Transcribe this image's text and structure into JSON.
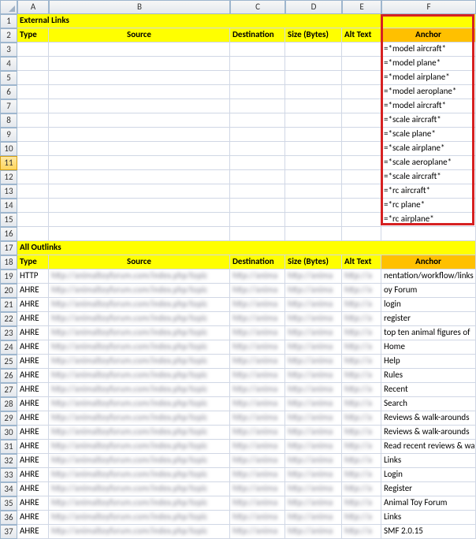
{
  "columns": [
    "A",
    "B",
    "C",
    "D",
    "E",
    "F"
  ],
  "rows": [
    1,
    2,
    3,
    4,
    5,
    6,
    7,
    8,
    9,
    10,
    11,
    12,
    13,
    14,
    15,
    16,
    17,
    18,
    19,
    20,
    21,
    22,
    23,
    24,
    25,
    26,
    27,
    28,
    29,
    30,
    31,
    32,
    33,
    34,
    35,
    36,
    37
  ],
  "selectedRow": 11,
  "section1": {
    "title": "External Links",
    "headers": {
      "type": "Type",
      "source": "Source",
      "destination": "Destination",
      "size": "Size (Bytes)",
      "alt": "Alt Text",
      "anchor": "Anchor"
    },
    "anchors": [
      "=*model aircraft*",
      "=*model plane*",
      "=*model airplane*",
      "=*model aeroplane*",
      "=*model aircraft*",
      "=*scale aircraft*",
      "=*scale plane*",
      "=*scale airplane*",
      "=*scale aeroplane*",
      "=*scale aircraft*",
      "=*rc aircraft*",
      "=*rc plane*",
      "=*rc airplane*"
    ]
  },
  "section2": {
    "title": "All Outlinks",
    "headers": {
      "type": "Type",
      "source": "Source",
      "destination": "Destination",
      "size": "Size (Bytes)",
      "alt": "Alt Text",
      "anchor": "Anchor"
    },
    "rows": [
      {
        "type": "HTTP",
        "anchor": "nentation/workflow/links"
      },
      {
        "type": "AHRE",
        "anchor": "oy Forum"
      },
      {
        "type": "AHRE",
        "anchor": "login"
      },
      {
        "type": "AHRE",
        "anchor": "register"
      },
      {
        "type": "AHRE",
        "anchor": "top ten animal figures of"
      },
      {
        "type": "AHRE",
        "anchor": "Home"
      },
      {
        "type": "AHRE",
        "anchor": "Help"
      },
      {
        "type": "AHRE",
        "anchor": "Rules"
      },
      {
        "type": "AHRE",
        "anchor": "Recent"
      },
      {
        "type": "AHRE",
        "anchor": "Search"
      },
      {
        "type": "AHRE",
        "anchor": "Reviews & walk-arounds"
      },
      {
        "type": "AHRE",
        "anchor": "Reviews & walk-arounds"
      },
      {
        "type": "AHRE",
        "anchor": "Read recent reviews & wa"
      },
      {
        "type": "AHRE",
        "anchor": "Links"
      },
      {
        "type": "AHRE",
        "anchor": "Login"
      },
      {
        "type": "AHRE",
        "anchor": "Register"
      },
      {
        "type": "AHRE",
        "anchor": "Animal Toy Forum"
      },
      {
        "type": "AHRE",
        "anchor": "Links"
      },
      {
        "type": "AHRE",
        "anchor": "SMF 2.0.15"
      }
    ]
  },
  "blurText": "http://animaltoyforum.com/index.php/topic"
}
